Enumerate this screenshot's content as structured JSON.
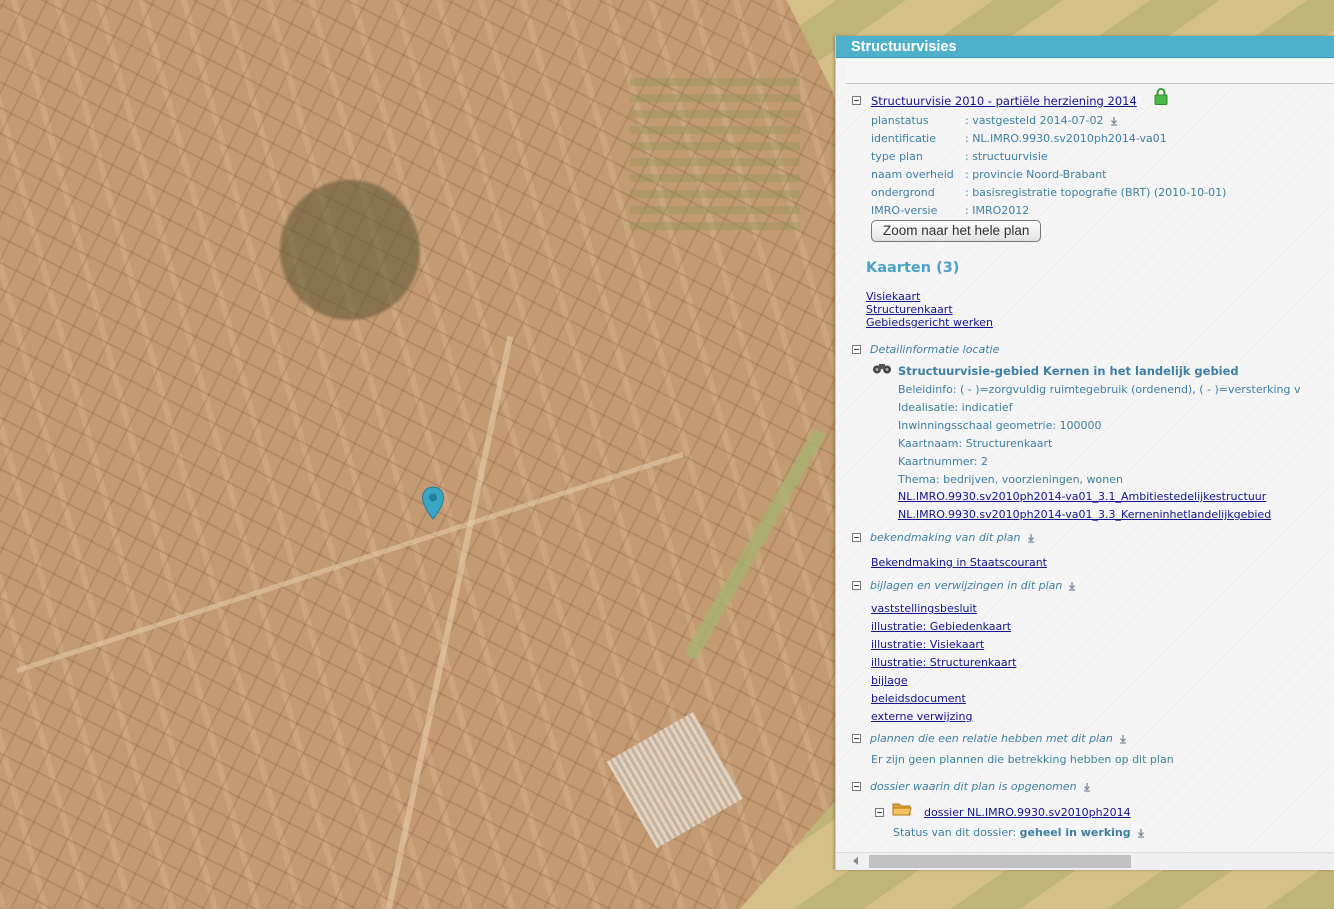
{
  "panel": {
    "title": "Structuurvisies"
  },
  "plan": {
    "title": "Structuurvisie 2010 - partiële herziening 2014",
    "fields": [
      {
        "label": "planstatus",
        "value": ": vastgesteld 2014-07-02"
      },
      {
        "label": "identificatie",
        "value": ": NL.IMRO.9930.sv2010ph2014-va01"
      },
      {
        "label": "type plan",
        "value": ": structuurvisie"
      },
      {
        "label": "naam overheid",
        "value": ": provincie Noord-Brabant"
      },
      {
        "label": "ondergrond",
        "value": ": basisregistratie topografie (BRT) (2010-10-01)"
      },
      {
        "label": "IMRO-versie",
        "value": ": IMRO2012"
      }
    ],
    "zoom_button": "Zoom naar het hele plan"
  },
  "kaarten": {
    "heading": "Kaarten (3)",
    "links": [
      "Visiekaart",
      "Structurenkaart",
      "Gebiedsgericht werken"
    ]
  },
  "detail": {
    "heading": "Detailinformatie locatie",
    "title": "Structuurvisie-gebied Kernen in het landelijk gebied",
    "lines": [
      "Beleidinfo: ( - )=zorgvuldig ruimtegebruik (ordenend), ( - )=versterking v",
      "Idealisatie: indicatief",
      "Inwinningsschaal geometrie: 100000",
      "Kaartnaam: Structurenkaart",
      "Kaartnummer: 2",
      "Thema: bedrijven, voorzieningen, wonen"
    ],
    "links": [
      "NL.IMRO.9930.sv2010ph2014-va01_3.1_Ambitiestedelijkestructuur",
      "NL.IMRO.9930.sv2010ph2014-va01_3.3_Kerneninhetlandelijkgebied"
    ]
  },
  "bekendmaking": {
    "heading": "bekendmaking van dit plan",
    "link": "Bekendmaking in Staatscourant"
  },
  "bijlagen": {
    "heading": "bijlagen en verwijzingen in dit plan",
    "links": [
      "vaststellingsbesluit",
      "illustratie: Gebiedenkaart",
      "illustratie: Visiekaart",
      "illustratie: Structurenkaart",
      "bijlage",
      "beleidsdocument",
      "externe verwijzing"
    ]
  },
  "relaties": {
    "heading": "plannen die een relatie hebben met dit plan",
    "text": "Er zijn geen plannen die betrekking hebben op dit plan"
  },
  "dossier": {
    "heading": "dossier waarin dit plan is opgenomen",
    "link": "dossier NL.IMRO.9930.sv2010ph2014",
    "status_label": "Status van dit dossier:",
    "status_value": "geheel in werking"
  },
  "colors": {
    "header": "#4fb0cb",
    "link": "#15148f",
    "label": "#3e7fa1",
    "pin": "#3aa6c4",
    "lock": "#4db848"
  },
  "icons": {
    "pin": "map-pin-icon",
    "lock": "lock-icon",
    "info": "info-icon",
    "binoculars": "binoculars-icon",
    "folder": "folder-icon",
    "collapse": "collapse-toggle-icon"
  }
}
